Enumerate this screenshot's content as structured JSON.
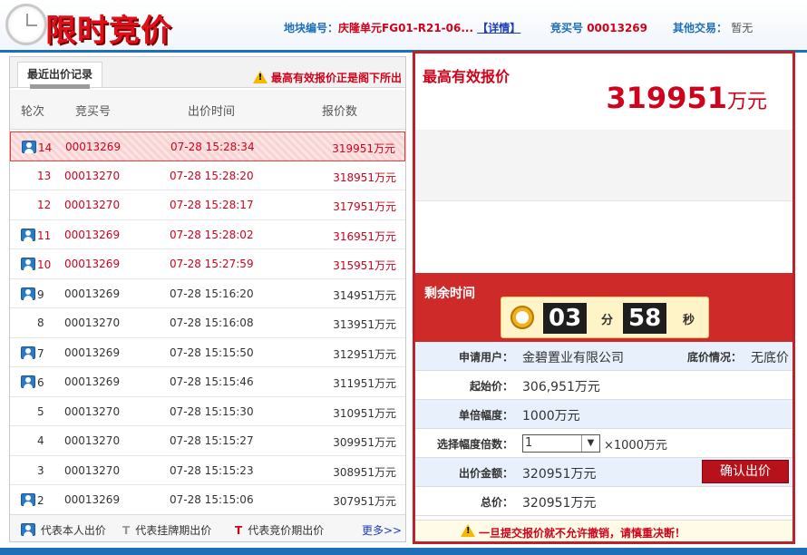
{
  "header": {
    "title": "限时竞价",
    "plot_label": "地块编号：",
    "plot_value": "庆隆单元FG01-R21-06...",
    "detail_link": "【详情】",
    "bidder_label": "竞买号",
    "bidder_value": "00013269",
    "other_label": "其他交易：",
    "other_value": "暂无"
  },
  "left": {
    "tab": "最近出价记录",
    "warning": "最高有效报价正是阁下所出",
    "columns": [
      "轮次",
      "竞买号",
      "出价时间",
      "报价数"
    ],
    "rows": [
      {
        "round": "14",
        "bidder": "00013269",
        "time": "07-28 15:28:34",
        "price": "319951万元"
      },
      {
        "round": "13",
        "bidder": "00013270",
        "time": "07-28 15:28:20",
        "price": "318951万元"
      },
      {
        "round": "12",
        "bidder": "00013270",
        "time": "07-28 15:28:17",
        "price": "317951万元"
      },
      {
        "round": "11",
        "bidder": "00013269",
        "time": "07-28 15:28:02",
        "price": "316951万元"
      },
      {
        "round": "10",
        "bidder": "00013269",
        "time": "07-28 15:27:59",
        "price": "315951万元"
      },
      {
        "round": "9",
        "bidder": "00013269",
        "time": "07-28 15:16:20",
        "price": "314951万元"
      },
      {
        "round": "8",
        "bidder": "00013270",
        "time": "07-28 15:16:08",
        "price": "313951万元"
      },
      {
        "round": "7",
        "bidder": "00013269",
        "time": "07-28 15:15:50",
        "price": "312951万元"
      },
      {
        "round": "6",
        "bidder": "00013269",
        "time": "07-28 15:15:46",
        "price": "311951万元"
      },
      {
        "round": "5",
        "bidder": "00013270",
        "time": "07-28 15:15:30",
        "price": "310951万元"
      },
      {
        "round": "4",
        "bidder": "00013270",
        "time": "07-28 15:15:27",
        "price": "309951万元"
      },
      {
        "round": "3",
        "bidder": "00013270",
        "time": "07-28 15:15:23",
        "price": "308951万元"
      },
      {
        "round": "2",
        "bidder": "00013269",
        "time": "07-28 15:15:06",
        "price": "307951万元"
      }
    ],
    "legend": {
      "self": "代表本人出价",
      "t_glyph": "T",
      "listing": "代表挂牌期出价",
      "auction": "代表竞价期出价",
      "more": "更多>>"
    }
  },
  "right": {
    "highest_label": "最高有效报价",
    "highest_value": "319951",
    "highest_unit": "万元",
    "remaining_label": "剩余时间",
    "minutes": "03",
    "minutes_unit": "分",
    "seconds": "58",
    "seconds_unit": "秒",
    "applicant_label": "申请用户：",
    "applicant_value": "金碧置业有限公司",
    "reserve_label": "底价情况：",
    "reserve_value": "无底价",
    "start_label": "起始价：",
    "start_value": "306,951万元",
    "step_label": "单倍幅度：",
    "step_value": "1000万元",
    "multiple_label": "选择幅度倍数：",
    "multiple_value": "1",
    "multiple_suffix": "×1000万元",
    "amount_label": "出价金额：",
    "amount_value": "320951万元",
    "confirm_button": "确认出价",
    "total_label": "总价：",
    "total_value": "320951万元",
    "footer_warning": "一旦提交报价就不允许撤销，请慎重决断！"
  }
}
